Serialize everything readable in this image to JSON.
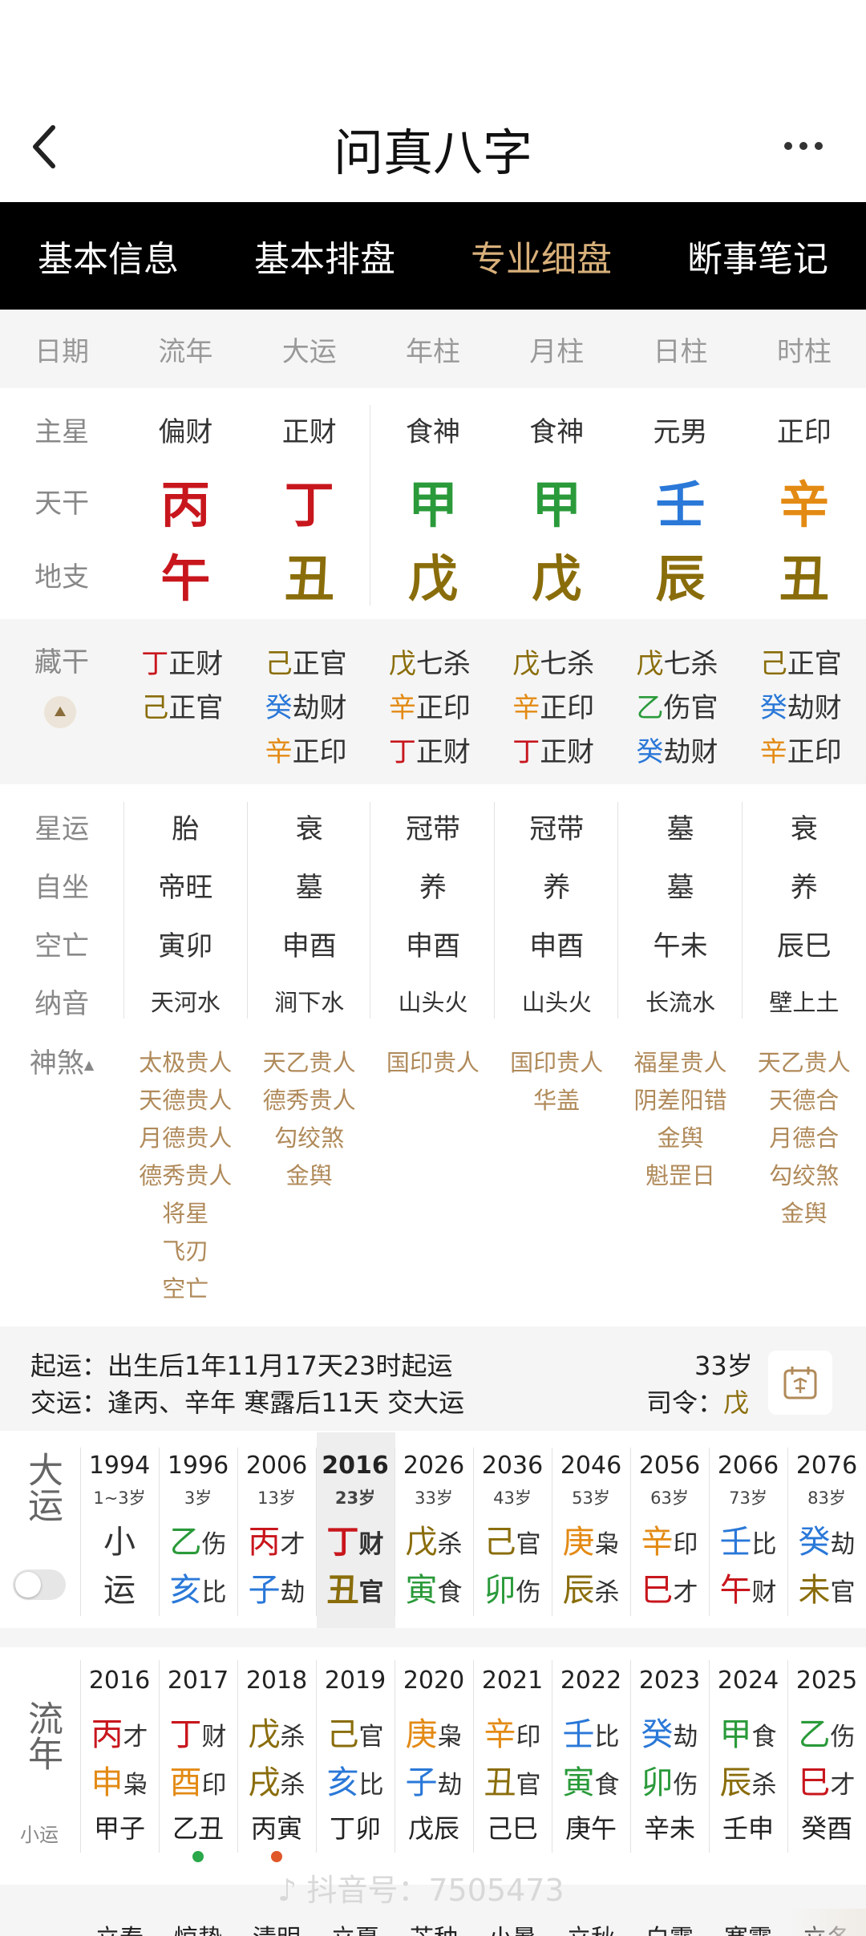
{
  "header": {
    "title": "问真八字",
    "back": "<",
    "more": "···"
  },
  "tabs": [
    "基本信息",
    "基本排盘",
    "专业细盘",
    "断事笔记"
  ],
  "columns": [
    "日期",
    "流年",
    "大运",
    "年柱",
    "月柱",
    "日柱",
    "时柱"
  ],
  "row_labels": {
    "main_star": "主星",
    "tiangan": "天干",
    "dizhi": "地支",
    "canggan": "藏干",
    "xingyun": "星运",
    "zizuo": "自坐",
    "kongwang": "空亡",
    "nayin": "纳音",
    "shensha": "神煞"
  },
  "main_star": [
    "偏财",
    "正财",
    "食神",
    "食神",
    "元男",
    "正印"
  ],
  "tiangan": [
    "丙",
    "丁",
    "甲",
    "甲",
    "壬",
    "辛"
  ],
  "dizhi": [
    "午",
    "丑",
    "戊",
    "戊",
    "辰",
    "丑"
  ],
  "canggan": [
    [
      {
        "g": "丁",
        "t": "正财",
        "c": "red"
      },
      {
        "g": "己",
        "t": "正官",
        "c": "gold"
      }
    ],
    [
      {
        "g": "己",
        "t": "正官",
        "c": "gold"
      },
      {
        "g": "癸",
        "t": "劫财",
        "c": "blue"
      },
      {
        "g": "辛",
        "t": "正印",
        "c": "orange"
      }
    ],
    [
      {
        "g": "戊",
        "t": "七杀",
        "c": "gold"
      },
      {
        "g": "辛",
        "t": "正印",
        "c": "orange"
      },
      {
        "g": "丁",
        "t": "正财",
        "c": "red"
      }
    ],
    [
      {
        "g": "戊",
        "t": "七杀",
        "c": "gold"
      },
      {
        "g": "辛",
        "t": "正印",
        "c": "orange"
      },
      {
        "g": "丁",
        "t": "正财",
        "c": "red"
      }
    ],
    [
      {
        "g": "戊",
        "t": "七杀",
        "c": "gold"
      },
      {
        "g": "乙",
        "t": "伤官",
        "c": "green"
      },
      {
        "g": "癸",
        "t": "劫财",
        "c": "blue"
      }
    ],
    [
      {
        "g": "己",
        "t": "正官",
        "c": "gold"
      },
      {
        "g": "癸",
        "t": "劫财",
        "c": "blue"
      },
      {
        "g": "辛",
        "t": "正印",
        "c": "orange"
      }
    ]
  ],
  "xingyun": [
    "胎",
    "衰",
    "冠带",
    "冠带",
    "墓",
    "衰"
  ],
  "zizuo": [
    "帝旺",
    "墓",
    "养",
    "养",
    "墓",
    "养"
  ],
  "kongwang": [
    "寅卯",
    "申酉",
    "申酉",
    "申酉",
    "午未",
    "辰巳"
  ],
  "nayin": [
    "天河水",
    "涧下水",
    "山头火",
    "山头火",
    "长流水",
    "壁上土"
  ],
  "shensha": [
    [
      "太极贵人",
      "天德贵人",
      "月德贵人",
      "德秀贵人",
      "将星",
      "飞刃",
      "空亡"
    ],
    [
      "天乙贵人",
      "德秀贵人",
      "勾绞煞",
      "金舆"
    ],
    [
      "国印贵人"
    ],
    [
      "国印贵人",
      "华盖"
    ],
    [
      "福星贵人",
      "阴差阳错",
      "金舆",
      "魁罡日"
    ],
    [
      "天乙贵人",
      "天德合",
      "月德合",
      "勾绞煞",
      "金舆"
    ]
  ],
  "qiyun": {
    "label1": "起运：",
    "text1": "出生后1年11月17天23时起运",
    "label2": "交运：",
    "text2": "逢丙、辛年 寒露后11天 交大运",
    "age": "33岁",
    "siling_label": "司令：",
    "siling": "戊"
  },
  "dayun": {
    "label": "大运",
    "items": [
      {
        "y": "1994",
        "a": "1~3岁",
        "g": "小",
        "gs": "",
        "gc": "dark",
        "z": "运",
        "zs": "",
        "zc": "dark"
      },
      {
        "y": "1996",
        "a": "3岁",
        "g": "乙",
        "gs": "伤",
        "gc": "green",
        "z": "亥",
        "zs": "比",
        "zc": "blue"
      },
      {
        "y": "2006",
        "a": "13岁",
        "g": "丙",
        "gs": "才",
        "gc": "red",
        "z": "子",
        "zs": "劫",
        "zc": "blue"
      },
      {
        "y": "2016",
        "a": "23岁",
        "g": "丁",
        "gs": "财",
        "gc": "red",
        "z": "丑",
        "zs": "官",
        "zc": "gold"
      },
      {
        "y": "2026",
        "a": "33岁",
        "g": "戊",
        "gs": "杀",
        "gc": "gold",
        "z": "寅",
        "zs": "食",
        "zc": "green"
      },
      {
        "y": "2036",
        "a": "43岁",
        "g": "己",
        "gs": "官",
        "gc": "gold",
        "z": "卯",
        "zs": "伤",
        "zc": "green"
      },
      {
        "y": "2046",
        "a": "53岁",
        "g": "庚",
        "gs": "枭",
        "gc": "orange",
        "z": "辰",
        "zs": "杀",
        "zc": "gold"
      },
      {
        "y": "2056",
        "a": "63岁",
        "g": "辛",
        "gs": "印",
        "gc": "orange",
        "z": "巳",
        "zs": "才",
        "zc": "red"
      },
      {
        "y": "2066",
        "a": "73岁",
        "g": "壬",
        "gs": "比",
        "gc": "blue",
        "z": "午",
        "zs": "财",
        "zc": "red"
      },
      {
        "y": "2076",
        "a": "83岁",
        "g": "癸",
        "gs": "劫",
        "gc": "blue",
        "z": "未",
        "zs": "官",
        "zc": "gold"
      }
    ]
  },
  "liunian": {
    "label": "流年",
    "sub": "小运",
    "items": [
      {
        "y": "2016",
        "g": "丙",
        "gs": "才",
        "gc": "red",
        "z": "申",
        "zs": "枭",
        "zc": "orange",
        "x": "甲子"
      },
      {
        "y": "2017",
        "g": "丁",
        "gs": "财",
        "gc": "red",
        "z": "酉",
        "zs": "印",
        "zc": "orange",
        "x": "乙丑"
      },
      {
        "y": "2018",
        "g": "戊",
        "gs": "杀",
        "gc": "gold",
        "z": "戌",
        "zs": "杀",
        "zc": "gold",
        "x": "丙寅"
      },
      {
        "y": "2019",
        "g": "己",
        "gs": "官",
        "gc": "gold",
        "z": "亥",
        "zs": "比",
        "zc": "blue",
        "x": "丁卯"
      },
      {
        "y": "2020",
        "g": "庚",
        "gs": "枭",
        "gc": "orange",
        "z": "子",
        "zs": "劫",
        "zc": "blue",
        "x": "戊辰"
      },
      {
        "y": "2021",
        "g": "辛",
        "gs": "印",
        "gc": "orange",
        "z": "丑",
        "zs": "官",
        "zc": "gold",
        "x": "己巳"
      },
      {
        "y": "2022",
        "g": "壬",
        "gs": "比",
        "gc": "blue",
        "z": "寅",
        "zs": "食",
        "zc": "green",
        "x": "庚午"
      },
      {
        "y": "2023",
        "g": "癸",
        "gs": "劫",
        "gc": "blue",
        "z": "卯",
        "zs": "伤",
        "zc": "green",
        "x": "辛未"
      },
      {
        "y": "2024",
        "g": "甲",
        "gs": "食",
        "gc": "green",
        "z": "辰",
        "zs": "杀",
        "zc": "gold",
        "x": "壬申"
      },
      {
        "y": "2025",
        "g": "乙",
        "gs": "伤",
        "gc": "green",
        "z": "巳",
        "zs": "才",
        "zc": "red",
        "x": "癸酉"
      }
    ]
  },
  "jieqi": [
    "立春",
    "惊蛰",
    "清明",
    "立夏",
    "芒种",
    "小暑",
    "立秋",
    "白露",
    "寒露",
    "立冬"
  ],
  "watermark": "抖音号：7505473",
  "colors": {
    "red": "#c8161d",
    "gold": "#8a6d0b",
    "green": "#2a9a3a",
    "blue": "#2a78d8",
    "orange": "#e38a14",
    "dark": "#333333"
  }
}
